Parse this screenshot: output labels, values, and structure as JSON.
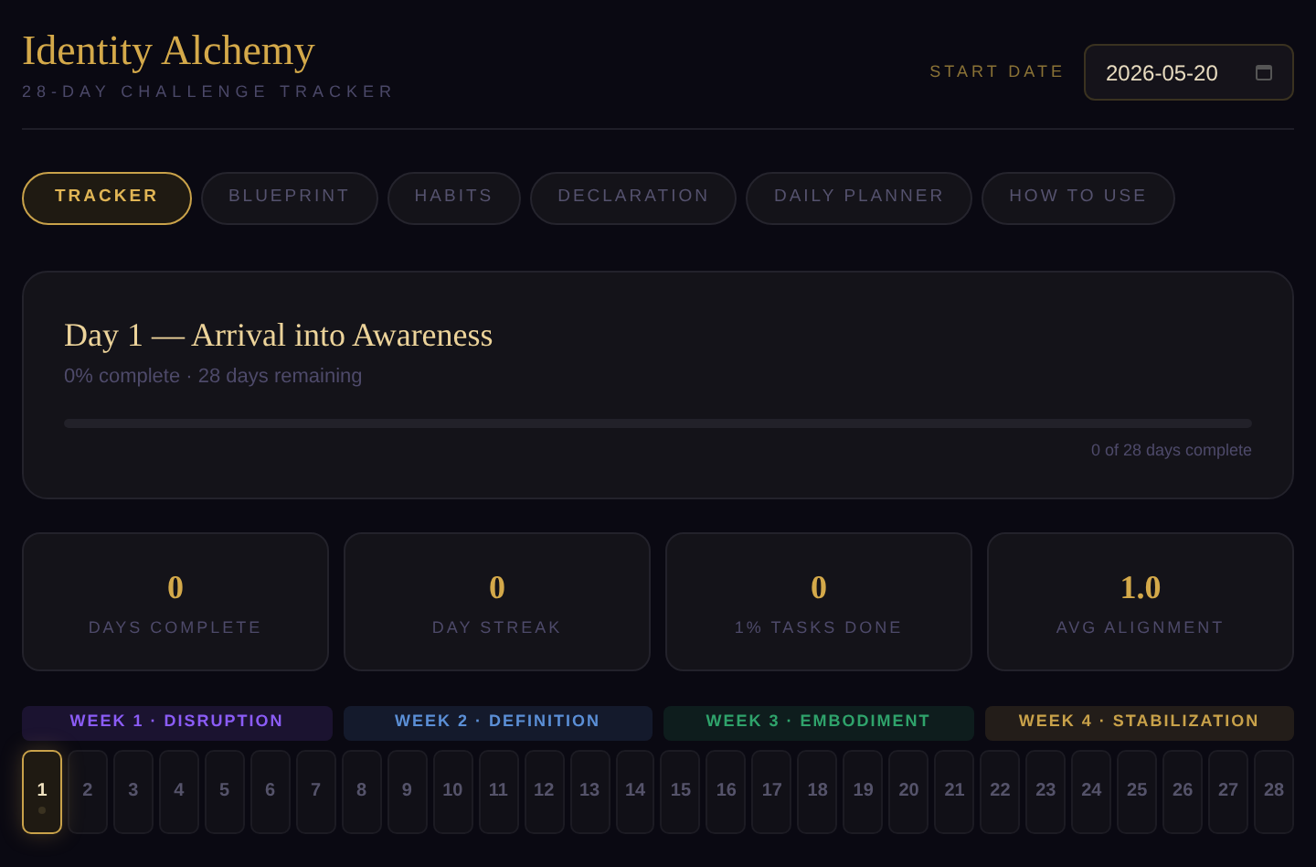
{
  "header": {
    "title": "Identity Alchemy",
    "subtitle": "28-DAY CHALLENGE TRACKER",
    "start_date": {
      "label": "START DATE",
      "value": "2026-05-20"
    }
  },
  "tabs": [
    {
      "label": "TRACKER",
      "selected": true
    },
    {
      "label": "BLUEPRINT",
      "selected": false
    },
    {
      "label": "HABITS",
      "selected": false
    },
    {
      "label": "DECLARATION",
      "selected": false
    },
    {
      "label": "DAILY PLANNER",
      "selected": false
    },
    {
      "label": "HOW TO USE",
      "selected": false
    }
  ],
  "day_card": {
    "title": "Day 1 — Arrival into Awareness",
    "summary": "0% complete · 28 days remaining",
    "progress": {
      "level": 0,
      "reading": "0 of 28 days complete"
    }
  },
  "stats": [
    {
      "value": "0",
      "label": "DAYS COMPLETE"
    },
    {
      "value": "0",
      "label": "DAY STREAK"
    },
    {
      "value": "0",
      "label": "1% TASKS DONE"
    },
    {
      "value": "1.0",
      "label": "AVG ALIGNMENT"
    }
  ],
  "weeks": [
    {
      "label": "WEEK 1 · DISRUPTION",
      "color": "#8b5cf6"
    },
    {
      "label": "WEEK 2 · DEFINITION",
      "color": "#5b8fd6"
    },
    {
      "label": "WEEK 3 · EMBODIMENT",
      "color": "#2fa36b"
    },
    {
      "label": "WEEK 4 · STABILIZATION",
      "color": "#c9a24a"
    }
  ],
  "days": [
    {
      "label": "1",
      "selected": true
    },
    {
      "label": "2",
      "selected": false
    },
    {
      "label": "3",
      "selected": false
    },
    {
      "label": "4",
      "selected": false
    },
    {
      "label": "5",
      "selected": false
    },
    {
      "label": "6",
      "selected": false
    },
    {
      "label": "7",
      "selected": false
    },
    {
      "label": "8",
      "selected": false
    },
    {
      "label": "9",
      "selected": false
    },
    {
      "label": "10",
      "selected": false
    },
    {
      "label": "11",
      "selected": false
    },
    {
      "label": "12",
      "selected": false
    },
    {
      "label": "13",
      "selected": false
    },
    {
      "label": "14",
      "selected": false
    },
    {
      "label": "15",
      "selected": false
    },
    {
      "label": "16",
      "selected": false
    },
    {
      "label": "17",
      "selected": false
    },
    {
      "label": "18",
      "selected": false
    },
    {
      "label": "19",
      "selected": false
    },
    {
      "label": "20",
      "selected": false
    },
    {
      "label": "21",
      "selected": false
    },
    {
      "label": "22",
      "selected": false
    },
    {
      "label": "23",
      "selected": false
    },
    {
      "label": "24",
      "selected": false
    },
    {
      "label": "25",
      "selected": false
    },
    {
      "label": "26",
      "selected": false
    },
    {
      "label": "27",
      "selected": false
    },
    {
      "label": "28",
      "selected": false
    }
  ]
}
